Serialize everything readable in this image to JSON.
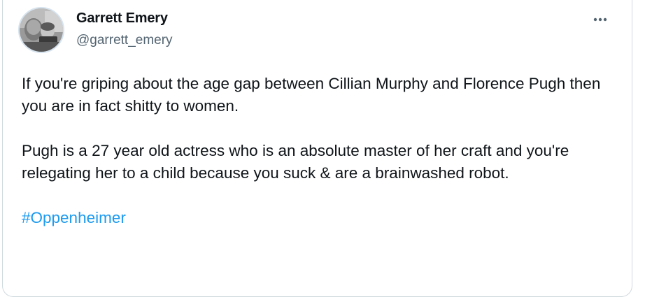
{
  "author": {
    "display_name": "Garrett Emery",
    "handle": "@garrett_emery"
  },
  "tweet": {
    "paragraph_1": "If you're griping about the age gap between Cillian Murphy and Florence Pugh then you are in fact shitty to women.",
    "paragraph_2": "Pugh is a 27 year old actress who is an absolute master of her craft and you're relegating her to a child because you suck & are a brainwashed robot.",
    "hashtag": "#Oppenheimer"
  },
  "colors": {
    "text": "#0f1419",
    "secondary": "#536471",
    "link": "#1d9bf0",
    "border": "#cfd9de"
  },
  "icons": {
    "more": "more-horizontal-icon"
  }
}
